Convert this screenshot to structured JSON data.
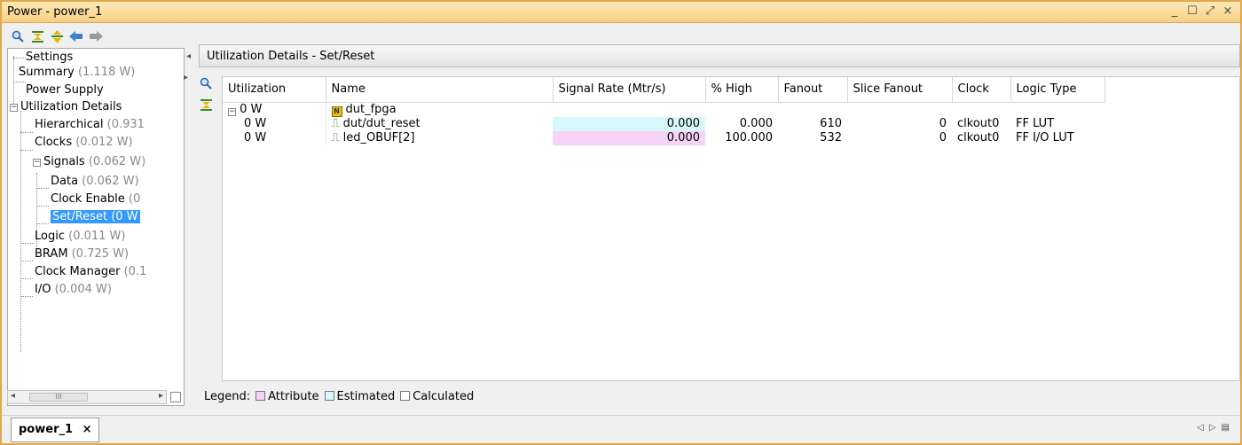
{
  "window": {
    "title": "Power - power_1",
    "controls": [
      "_",
      "☐",
      "⤢",
      "×"
    ]
  },
  "left_toolbar": {
    "icons": [
      "search-icon",
      "collapse-all-icon",
      "expand-all-icon",
      "back-arrow-icon",
      "forward-arrow-icon"
    ]
  },
  "tree": {
    "settings": "Settings",
    "summary": {
      "label": "Summary",
      "value": "(1.118 W)"
    },
    "power_supply": "Power Supply",
    "utilization_details": "Utilization Details",
    "hierarchical": {
      "label": "Hierarchical",
      "value": "(0.931"
    },
    "clocks": {
      "label": "Clocks",
      "value": "(0.012 W)"
    },
    "signals": {
      "label": "Signals",
      "value": "(0.062 W)"
    },
    "data": {
      "label": "Data",
      "value": "(0.062 W)"
    },
    "clock_enable": {
      "label": "Clock Enable",
      "value": "(0"
    },
    "set_reset": {
      "label": "Set/Reset",
      "value": "(0 W"
    },
    "logic": {
      "label": "Logic",
      "value": "(0.011 W)"
    },
    "bram": {
      "label": "BRAM",
      "value": "(0.725 W)"
    },
    "clock_manager": {
      "label": "Clock Manager",
      "value": "(0.1"
    },
    "io": {
      "label": "I/O",
      "value": "(0.004 W)"
    }
  },
  "panel": {
    "title": "Utilization Details - Set/Reset"
  },
  "table": {
    "headers": [
      "Utilization",
      "Name",
      "Signal Rate (Mtr/s)",
      "% High",
      "Fanout",
      "Slice Fanout",
      "Clock",
      "Logic Type"
    ],
    "rows": [
      {
        "utilization": "0 W",
        "name": "dut_fpga",
        "signal_rate": "",
        "pct_high": "",
        "fanout": "",
        "slice_fanout": "",
        "clock": "",
        "logic_type": ""
      },
      {
        "utilization": "0 W",
        "name": "dut/dut_reset",
        "signal_rate": "0.000",
        "pct_high": "0.000",
        "fanout": "610",
        "slice_fanout": "0",
        "clock": "clkout0",
        "logic_type": "FF LUT"
      },
      {
        "utilization": "0 W",
        "name": "led_OBUF[2]",
        "signal_rate": "0.000",
        "pct_high": "100.000",
        "fanout": "532",
        "slice_fanout": "0",
        "clock": "clkout0",
        "logic_type": "FF I/O LUT"
      }
    ]
  },
  "legend": {
    "label": "Legend:",
    "attribute": "Attribute",
    "estimated": "Estimated",
    "calculated": "Calculated"
  },
  "colors": {
    "attribute": "#f7d3f7",
    "estimated": "#d6f7fb",
    "calculated": "#ffffff",
    "titlebar": "#f7cf83",
    "selection": "#3399ff"
  },
  "bottom_tab": {
    "label": "power_1",
    "close": "×"
  },
  "scrollbar_grip": "III"
}
